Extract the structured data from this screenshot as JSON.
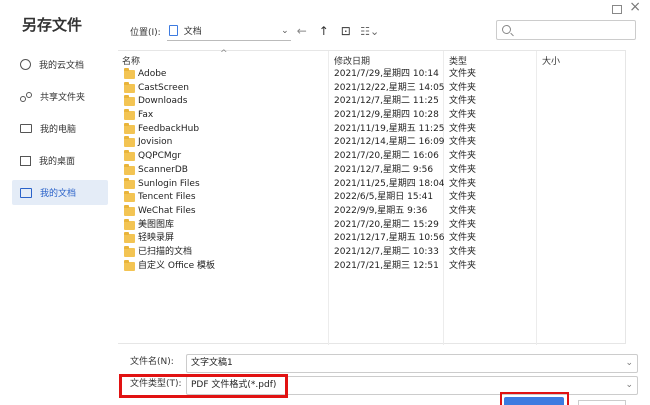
{
  "dialog": {
    "title": "另存文件"
  },
  "window": {
    "maximize_icon": "maximize-icon",
    "close_glyph": "×"
  },
  "sidebar": {
    "items": [
      {
        "label": "我的云文档",
        "icon": "cloud-icon"
      },
      {
        "label": "共享文件夹",
        "icon": "share-icon"
      },
      {
        "label": "我的电脑",
        "icon": "computer-icon"
      },
      {
        "label": "我的桌面",
        "icon": "desktop-icon"
      },
      {
        "label": "我的文档",
        "icon": "document-icon",
        "active": true
      }
    ]
  },
  "toolbar": {
    "location_label": "位置(I):",
    "location_value": "文档",
    "back_glyph": "←",
    "up_glyph": "↑",
    "new_folder_glyph": "⊡",
    "view_glyph": "☷⌄",
    "search_placeholder": ""
  },
  "columns": {
    "name": "名称",
    "date": "修改日期",
    "type": "类型",
    "size": "大小"
  },
  "files": [
    {
      "name": "Adobe",
      "date": "2021/7/29,星期四 10:14",
      "type": "文件夹"
    },
    {
      "name": "CastScreen",
      "date": "2021/12/22,星期三 14:05",
      "type": "文件夹"
    },
    {
      "name": "Downloads",
      "date": "2021/12/7,星期二 11:25",
      "type": "文件夹"
    },
    {
      "name": "Fax",
      "date": "2021/12/9,星期四 10:28",
      "type": "文件夹"
    },
    {
      "name": "FeedbackHub",
      "date": "2021/11/19,星期五 11:25",
      "type": "文件夹"
    },
    {
      "name": "Jovision",
      "date": "2021/12/14,星期二 16:09",
      "type": "文件夹"
    },
    {
      "name": "QQPCMgr",
      "date": "2021/7/20,星期二 16:06",
      "type": "文件夹"
    },
    {
      "name": "ScannerDB",
      "date": "2021/12/7,星期二 9:56",
      "type": "文件夹"
    },
    {
      "name": "Sunlogin Files",
      "date": "2021/11/25,星期四 18:04",
      "type": "文件夹"
    },
    {
      "name": "Tencent Files",
      "date": "2022/6/5,星期日 15:41",
      "type": "文件夹"
    },
    {
      "name": "WeChat Files",
      "date": "2022/9/9,星期五 9:36",
      "type": "文件夹"
    },
    {
      "name": "美图图库",
      "date": "2021/7/20,星期二 15:29",
      "type": "文件夹"
    },
    {
      "name": "轻映录屏",
      "date": "2021/12/17,星期五 10:56",
      "type": "文件夹"
    },
    {
      "name": "已扫描的文档",
      "date": "2021/12/7,星期二 10:33",
      "type": "文件夹"
    },
    {
      "name": "自定义 Office 模板",
      "date": "2021/7/21,星期三 12:51",
      "type": "文件夹"
    }
  ],
  "bottom": {
    "filename_label": "文件名(N):",
    "filename_value": "文字文稿1",
    "filetype_label": "文件类型(T):",
    "filetype_value": "PDF 文件格式(*.pdf)"
  },
  "colors": {
    "accent": "#3d7be0",
    "highlight": "#e11212",
    "folder": "#f3c453"
  }
}
